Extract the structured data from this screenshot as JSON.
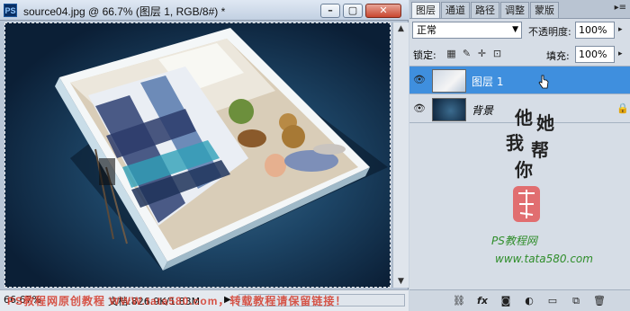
{
  "window": {
    "app_icon": "PS",
    "title": "source04.jpg @ 66.7% (图层 1, RGB/8#) *",
    "min": "–",
    "max": "▢",
    "close": "✕"
  },
  "status": {
    "zoom": "66.67%",
    "doc_info": "文档:826.9K/1.83M",
    "play": "▶"
  },
  "watermark": "PS教程网原创教程 WWW.tata580.com，转载教程请保留链接！",
  "panel": {
    "tabs": [
      "图层",
      "通道",
      "路径",
      "调整",
      "蒙版"
    ],
    "menu_icon": "▸≡",
    "blend_mode": "正常",
    "opacity_label": "不透明度:",
    "opacity_value": "100%",
    "lock_label": "锁定:",
    "lock_icons": [
      "transparency-lock-icon",
      "brush-lock-icon",
      "move-lock-icon",
      "all-lock-icon"
    ],
    "fill_label": "填充:",
    "fill_value": "100%",
    "layers": [
      {
        "name": "图层 1",
        "selected": true
      },
      {
        "name": "背景",
        "selected": false,
        "locked": true
      }
    ],
    "signature": {
      "lines": [
        "他",
        "她",
        "我",
        "帮",
        "你"
      ],
      "site_name": "PS教程网",
      "url": "www.tata580.com"
    },
    "bottom_icons": [
      "link-icon",
      "fx-icon",
      "mask-icon",
      "adjustment-icon",
      "folder-icon",
      "new-layer-icon",
      "trash-icon"
    ]
  },
  "colors": {
    "selection": "#3f8fde",
    "watermark": "#d43a2a"
  }
}
